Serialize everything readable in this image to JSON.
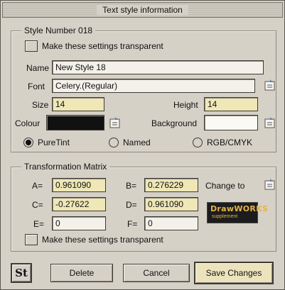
{
  "window": {
    "title": "Text style information"
  },
  "style_group": {
    "legend": "Style Number 018",
    "transparent_label": "Make these settings transparent",
    "name_label": "Name",
    "name_value": "New Style 18",
    "font_label": "Font",
    "font_value": "Celery.(Regular)",
    "size_label": "Size",
    "size_value": "14",
    "height_label": "Height",
    "height_value": "14",
    "colour_label": "Colour",
    "background_label": "Background",
    "colour_swatch": "#111111",
    "background_swatch": "#fbf9f3",
    "radios": [
      {
        "label": "PureTint",
        "selected": true
      },
      {
        "label": "Named",
        "selected": false
      },
      {
        "label": "RGB/CMYK",
        "selected": false
      }
    ]
  },
  "matrix_group": {
    "legend": "Transformation Matrix",
    "a_label": "A=",
    "a_value": "0.961090",
    "b_label": "B=",
    "b_value": "0.276229",
    "c_label": "C=",
    "c_value": "-0.27622",
    "d_label": "D=",
    "d_value": "0.961090",
    "e_label": "E=",
    "e_value": "0",
    "f_label": "F=",
    "f_value": "0",
    "change_to_label": "Change to",
    "transparent_label": "Make these settings transparent"
  },
  "logo": {
    "line1": "DrawWORKS",
    "line2": "supplement"
  },
  "footer": {
    "style_icon_text": "St",
    "delete_label": "Delete",
    "cancel_label": "Cancel",
    "save_label": "Save Changes"
  }
}
